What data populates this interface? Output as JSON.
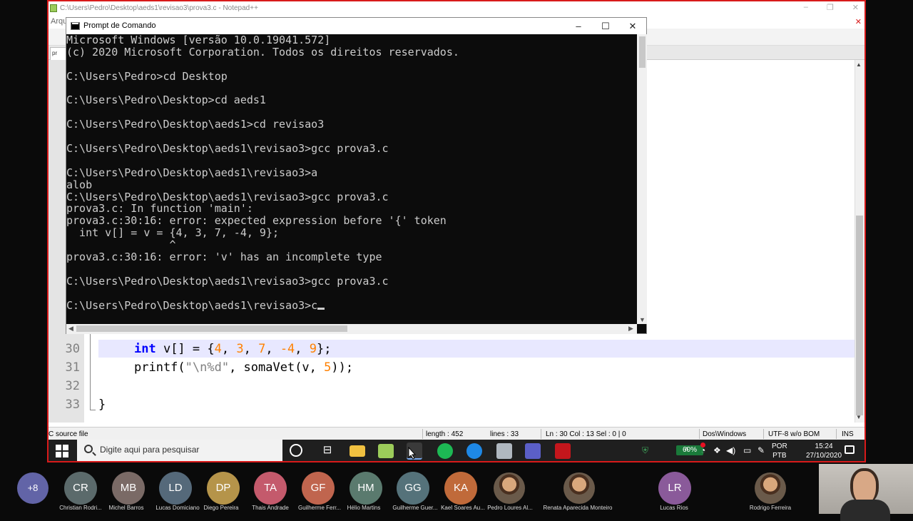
{
  "notepad": {
    "title": "C:\\Users\\Pedro\\Desktop\\aeds1\\revisao3\\prova3.c - Notepad++",
    "menu_first": "Arqu",
    "tab_label": "pr",
    "window_controls": [
      "–",
      "❐",
      "✕"
    ],
    "lines": [
      {
        "num": "30",
        "parts": [
          "int",
          " v[] = {",
          "4",
          ", ",
          "3",
          ", ",
          "7",
          ", ",
          "-4",
          ", ",
          "9",
          "};"
        ]
      },
      {
        "num": "31",
        "parts": [
          "printf(",
          "\"\\n%d\"",
          ", somaVet(v, ",
          "5",
          "));"
        ]
      },
      {
        "num": "32"
      },
      {
        "num": "33",
        "parts": [
          "}"
        ]
      }
    ],
    "status": {
      "type": "C source file",
      "length": "length : 452",
      "lines": "lines : 33",
      "pos": "Ln : 30    Col : 13    Sel : 0 | 0",
      "eol": "Dos\\Windows",
      "encoding": "UTF-8 w/o BOM",
      "mode": "INS"
    }
  },
  "cmd": {
    "title": "Prompt de Comando",
    "lines": [
      "Microsoft Windows [versão 10.0.19041.572]",
      "(c) 2020 Microsoft Corporation. Todos os direitos reservados.",
      "",
      "C:\\Users\\Pedro>cd Desktop",
      "",
      "C:\\Users\\Pedro\\Desktop>cd aeds1",
      "",
      "C:\\Users\\Pedro\\Desktop\\aeds1>cd revisao3",
      "",
      "C:\\Users\\Pedro\\Desktop\\aeds1\\revisao3>gcc prova3.c",
      "",
      "C:\\Users\\Pedro\\Desktop\\aeds1\\revisao3>a",
      "alob",
      "C:\\Users\\Pedro\\Desktop\\aeds1\\revisao3>gcc prova3.c",
      "prova3.c: In function 'main':",
      "prova3.c:30:16: error: expected expression before '{' token",
      "  int v[] = v = {4, 3, 7, -4, 9};",
      "                ^",
      "prova3.c:30:16: error: 'v' has an incomplete type",
      "",
      "C:\\Users\\Pedro\\Desktop\\aeds1\\revisao3>gcc prova3.c",
      "",
      "C:\\Users\\Pedro\\Desktop\\aeds1\\revisao3>c"
    ]
  },
  "taskbar": {
    "search_placeholder": "Digite aqui para pesquisar",
    "battery": "60%",
    "lang1": "POR",
    "lang2": "PTB",
    "time": "15:24",
    "date": "27/10/2020"
  },
  "participants": {
    "more": "+8",
    "items": [
      {
        "initials": "CR",
        "name": "Christian Rodri...",
        "color": "#5b6a6b"
      },
      {
        "initials": "MB",
        "name": "Michel Barros",
        "color": "#7a6a66"
      },
      {
        "initials": "LD",
        "name": "Lucas Domiciano",
        "color": "#55697a"
      },
      {
        "initials": "DP",
        "name": "Diego Pereira",
        "color": "#b5944a"
      },
      {
        "initials": "TA",
        "name": "Thais  Andrade",
        "color": "#c45a6c"
      },
      {
        "initials": "GF",
        "name": "Guilherme Ferr...",
        "color": "#c0654e"
      },
      {
        "initials": "HM",
        "name": "Hélio Martins",
        "color": "#5a7a6e"
      },
      {
        "initials": "GG",
        "name": "Guilherme Guer...",
        "color": "#55727a"
      },
      {
        "initials": "KA",
        "name": "Kael Soares Au...",
        "color": "#c06a3a"
      },
      {
        "initials": "",
        "name": "Pedro Loures Al...",
        "color": ""
      },
      {
        "initials": "",
        "name": "Renata Aparecida Monteiro",
        "color": ""
      },
      {
        "initials": "LR",
        "name": "Lucas Rios",
        "color": "#8a5a9a"
      },
      {
        "initials": "",
        "name": "Rodrigo Ferreira",
        "color": ""
      }
    ]
  }
}
